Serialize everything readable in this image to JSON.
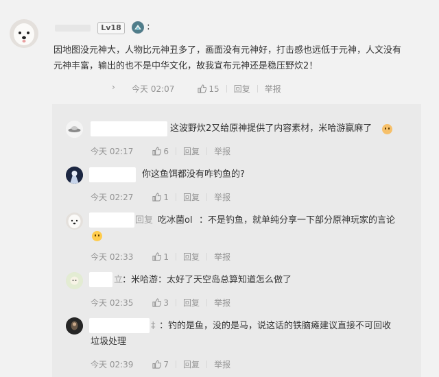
{
  "comment": {
    "level_badge": "Lv18",
    "colon": ":",
    "line1": "因地图没元神大，人物比元神丑多了，画面没有元神好，打击感也远低于元神，人文没有",
    "line2": "元神丰富，输出的也不是中华文化，故我宣布元神还是稳压野炊2！",
    "expand_icon": "chevron-right-icon",
    "time": "今天 02:07",
    "likes": "15",
    "reply_label": "回复",
    "report_label": "举报"
  },
  "replies": [
    {
      "text": "这波野炊2又给原神提供了内容素材，米哈游赢麻了",
      "time": "今天 02:17",
      "likes": "6",
      "reply_label": "回复",
      "report_label": "举报"
    },
    {
      "text": "你这鱼饵都没有咋钓鱼的?",
      "time": "今天 02:27",
      "likes": "1",
      "reply_label": "回复",
      "report_label": "举报"
    },
    {
      "prefix": "回复",
      "mention": "吃冰菌ol",
      "text": "：不是钓鱼，就单纯分享一下部分原神玩家的言论",
      "time": "今天 02:33",
      "likes": "1",
      "reply_label": "回复",
      "report_label": "举报"
    },
    {
      "prefix_char": "立",
      "text": "：米哈游：太好了天空岛总算知道怎么做了",
      "time": "今天 02:35",
      "likes": "3",
      "reply_label": "回复",
      "report_label": "举报"
    },
    {
      "prefix_char": "‡",
      "line1": "：钓的是鱼，没的是马，说这话的铁脑瘫建议直接不可回收",
      "line2": "垃圾处理",
      "time": "今天 02:39",
      "likes": "7",
      "reply_label": "回复",
      "report_label": "举报"
    }
  ],
  "colors": {
    "background": "#f2f2f2",
    "reply_background": "#eaeaea",
    "text": "#333333",
    "muted": "#939393"
  }
}
